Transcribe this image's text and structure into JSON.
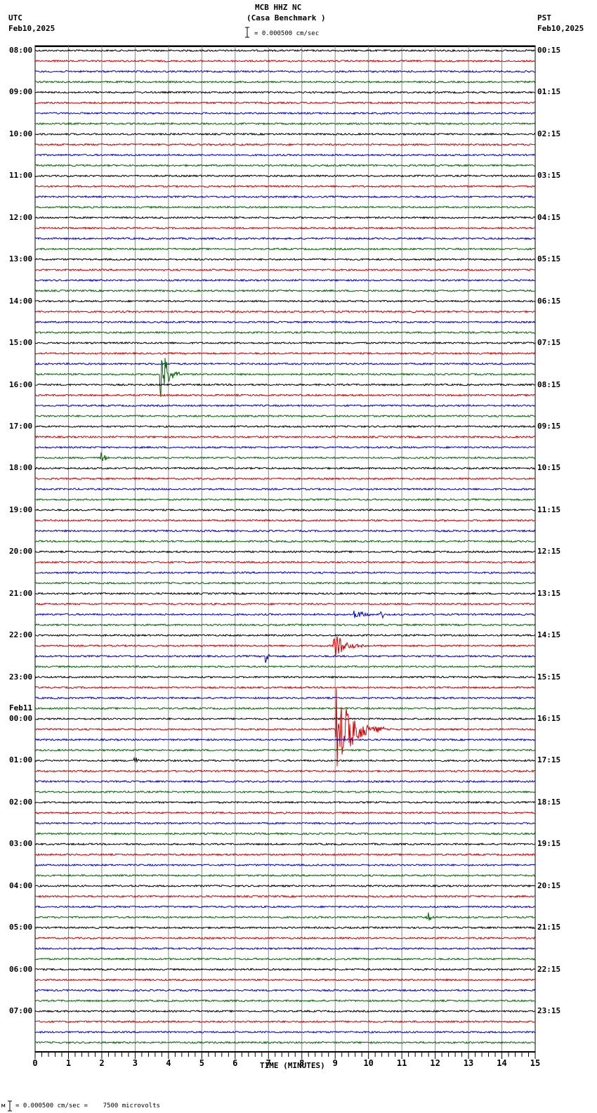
{
  "header": {
    "station": "MCB HHZ NC",
    "site": "(Casa Benchmark )",
    "left_zone": "UTC",
    "left_date": "Feb10,2025",
    "right_zone": "PST",
    "right_date": "Feb10,2025",
    "scale": "= 0.000500 cm/sec"
  },
  "footer": {
    "scale": "= 0.000500 cm/sec =    7500 microvolts",
    "mark": "м"
  },
  "chart_data": {
    "type": "line",
    "title": "MCB HHZ NC (Casa Benchmark )",
    "xlabel": "TIME (MINUTES)",
    "xlim": [
      0,
      15
    ],
    "x_ticks": [
      "0",
      "1",
      "2",
      "3",
      "4",
      "5",
      "6",
      "7",
      "8",
      "9",
      "10",
      "11",
      "12",
      "13",
      "14",
      "15"
    ],
    "left_labels": [
      "08:00",
      "09:00",
      "10:00",
      "11:00",
      "12:00",
      "13:00",
      "14:00",
      "15:00",
      "16:00",
      "17:00",
      "18:00",
      "19:00",
      "20:00",
      "21:00",
      "22:00",
      "23:00",
      "00:00",
      "01:00",
      "02:00",
      "03:00",
      "04:00",
      "05:00",
      "06:00",
      "07:00"
    ],
    "date_change_label": "Feb11",
    "date_change_index": 16,
    "right_labels": [
      "00:15",
      "01:15",
      "02:15",
      "03:15",
      "04:15",
      "05:15",
      "06:15",
      "07:15",
      "08:15",
      "09:15",
      "10:15",
      "11:15",
      "12:15",
      "13:15",
      "14:15",
      "15:15",
      "16:15",
      "17:15",
      "18:15",
      "19:15",
      "20:15",
      "21:15",
      "22:15",
      "23:15"
    ],
    "traces_per_hour": 4,
    "trace_colors": [
      "#000000",
      "#cc0000",
      "#0000cc",
      "#006600"
    ],
    "events": [
      {
        "trace": 31,
        "minute": 3.8,
        "amplitude": 3.0,
        "duration": 0.6
      },
      {
        "trace": 39,
        "minute": 2.0,
        "amplitude": 0.5,
        "duration": 0.4
      },
      {
        "trace": 54,
        "minute": 9.6,
        "amplitude": 0.5,
        "duration": 0.6
      },
      {
        "trace": 54,
        "minute": 10.4,
        "amplitude": 0.4,
        "duration": 0.3
      },
      {
        "trace": 58,
        "minute": 6.95,
        "amplitude": 0.9,
        "duration": 0.1
      },
      {
        "trace": 57,
        "minute": 9.0,
        "amplitude": 1.2,
        "duration": 1.0
      },
      {
        "trace": 65,
        "minute": 9.05,
        "amplitude": 4.0,
        "duration": 1.4
      },
      {
        "trace": 68,
        "minute": 3.0,
        "amplitude": 0.5,
        "duration": 0.2
      },
      {
        "trace": 83,
        "minute": 11.8,
        "amplitude": 0.6,
        "duration": 0.2
      }
    ]
  }
}
